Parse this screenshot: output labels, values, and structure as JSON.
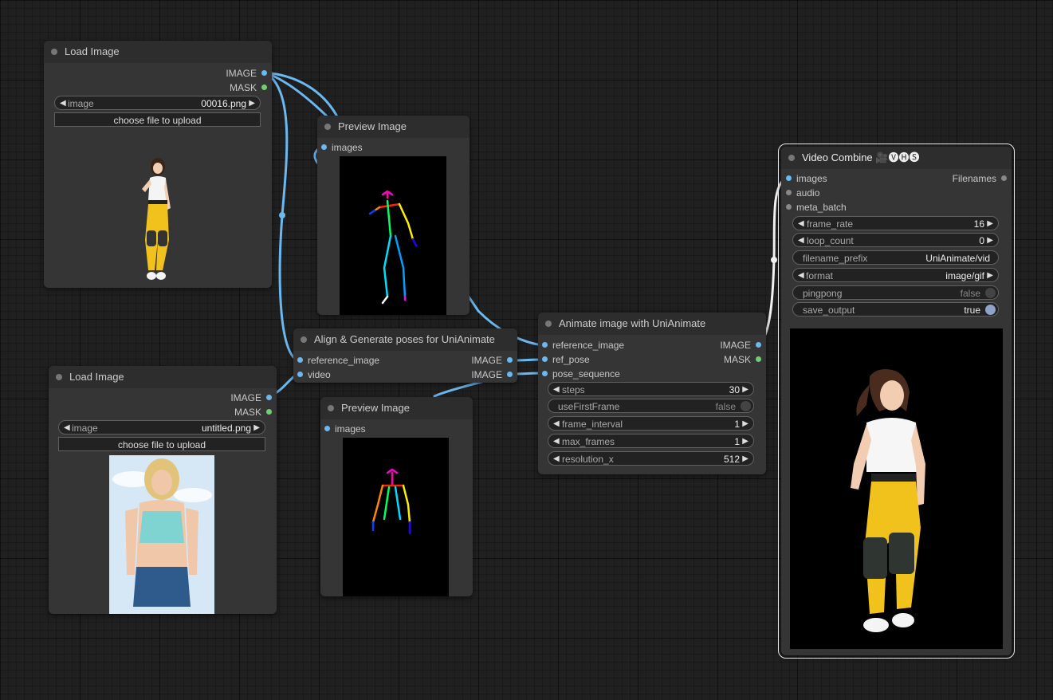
{
  "colors": {
    "canvas": "#202020",
    "node": "#353535",
    "link_image": "#6cb8f0",
    "link_mask": "#70d070"
  },
  "nodes": {
    "load_image_1": {
      "title": "Load Image",
      "outputs": [
        "IMAGE",
        "MASK"
      ],
      "widget_image": {
        "label": "image",
        "value": "00016.png"
      },
      "upload_button": "choose file to upload"
    },
    "load_image_2": {
      "title": "Load Image",
      "outputs": [
        "IMAGE",
        "MASK"
      ],
      "widget_image": {
        "label": "image",
        "value": "untitled.png"
      },
      "upload_button": "choose file to upload"
    },
    "preview_1": {
      "title": "Preview Image",
      "inputs": [
        "images"
      ]
    },
    "preview_2": {
      "title": "Preview Image",
      "inputs": [
        "images"
      ]
    },
    "align": {
      "title": "Align & Generate poses for UniAnimate",
      "inputs": [
        "reference_image",
        "video"
      ],
      "outputs": [
        "IMAGE",
        "IMAGE"
      ]
    },
    "animate": {
      "title": "Animate image with UniAnimate",
      "inputs": [
        "reference_image",
        "ref_pose",
        "pose_sequence"
      ],
      "outputs": [
        "IMAGE",
        "MASK"
      ],
      "widgets": [
        {
          "label": "steps",
          "value": "30"
        },
        {
          "label": "useFirstFrame",
          "value": "false"
        },
        {
          "label": "frame_interval",
          "value": "1"
        },
        {
          "label": "max_frames",
          "value": "1"
        },
        {
          "label": "resolution_x",
          "value": "512"
        }
      ]
    },
    "video_combine": {
      "title": "Video Combine 🎥🅥🅗🅢",
      "inputs": [
        "images",
        "audio",
        "meta_batch"
      ],
      "outputs": [
        "Filenames"
      ],
      "widgets": [
        {
          "label": "frame_rate",
          "value": "16"
        },
        {
          "label": "loop_count",
          "value": "0"
        },
        {
          "label": "filename_prefix",
          "value": "UniAnimate/vid"
        },
        {
          "label": "format",
          "value": "image/gif"
        },
        {
          "label": "pingpong",
          "value": "false"
        },
        {
          "label": "save_output",
          "value": "true"
        }
      ]
    }
  }
}
